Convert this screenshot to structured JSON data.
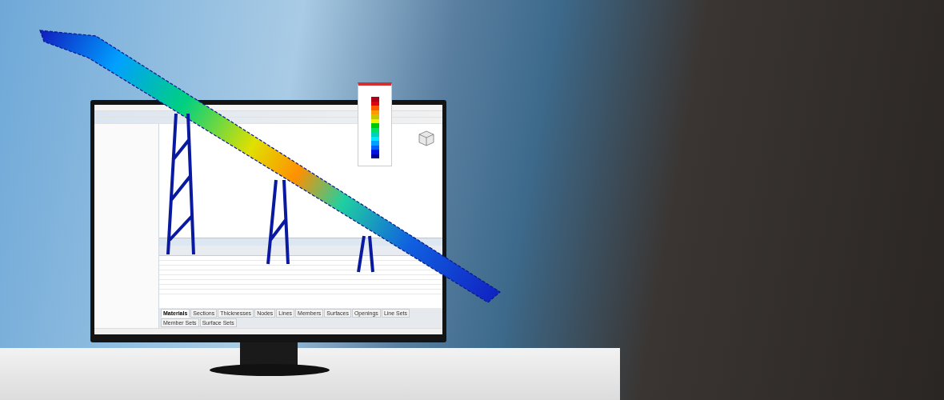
{
  "monitor": {
    "app": {
      "bottom_tabs": [
        {
          "label": "Materials",
          "selected": true
        },
        {
          "label": "Sections",
          "selected": false
        },
        {
          "label": "Thicknesses",
          "selected": false
        },
        {
          "label": "Nodes",
          "selected": false
        },
        {
          "label": "Lines",
          "selected": false
        },
        {
          "label": "Members",
          "selected": false
        },
        {
          "label": "Surfaces",
          "selected": false
        },
        {
          "label": "Openings",
          "selected": false
        },
        {
          "label": "Line Sets",
          "selected": false
        },
        {
          "label": "Member Sets",
          "selected": false
        },
        {
          "label": "Surface Sets",
          "selected": false
        }
      ]
    }
  }
}
